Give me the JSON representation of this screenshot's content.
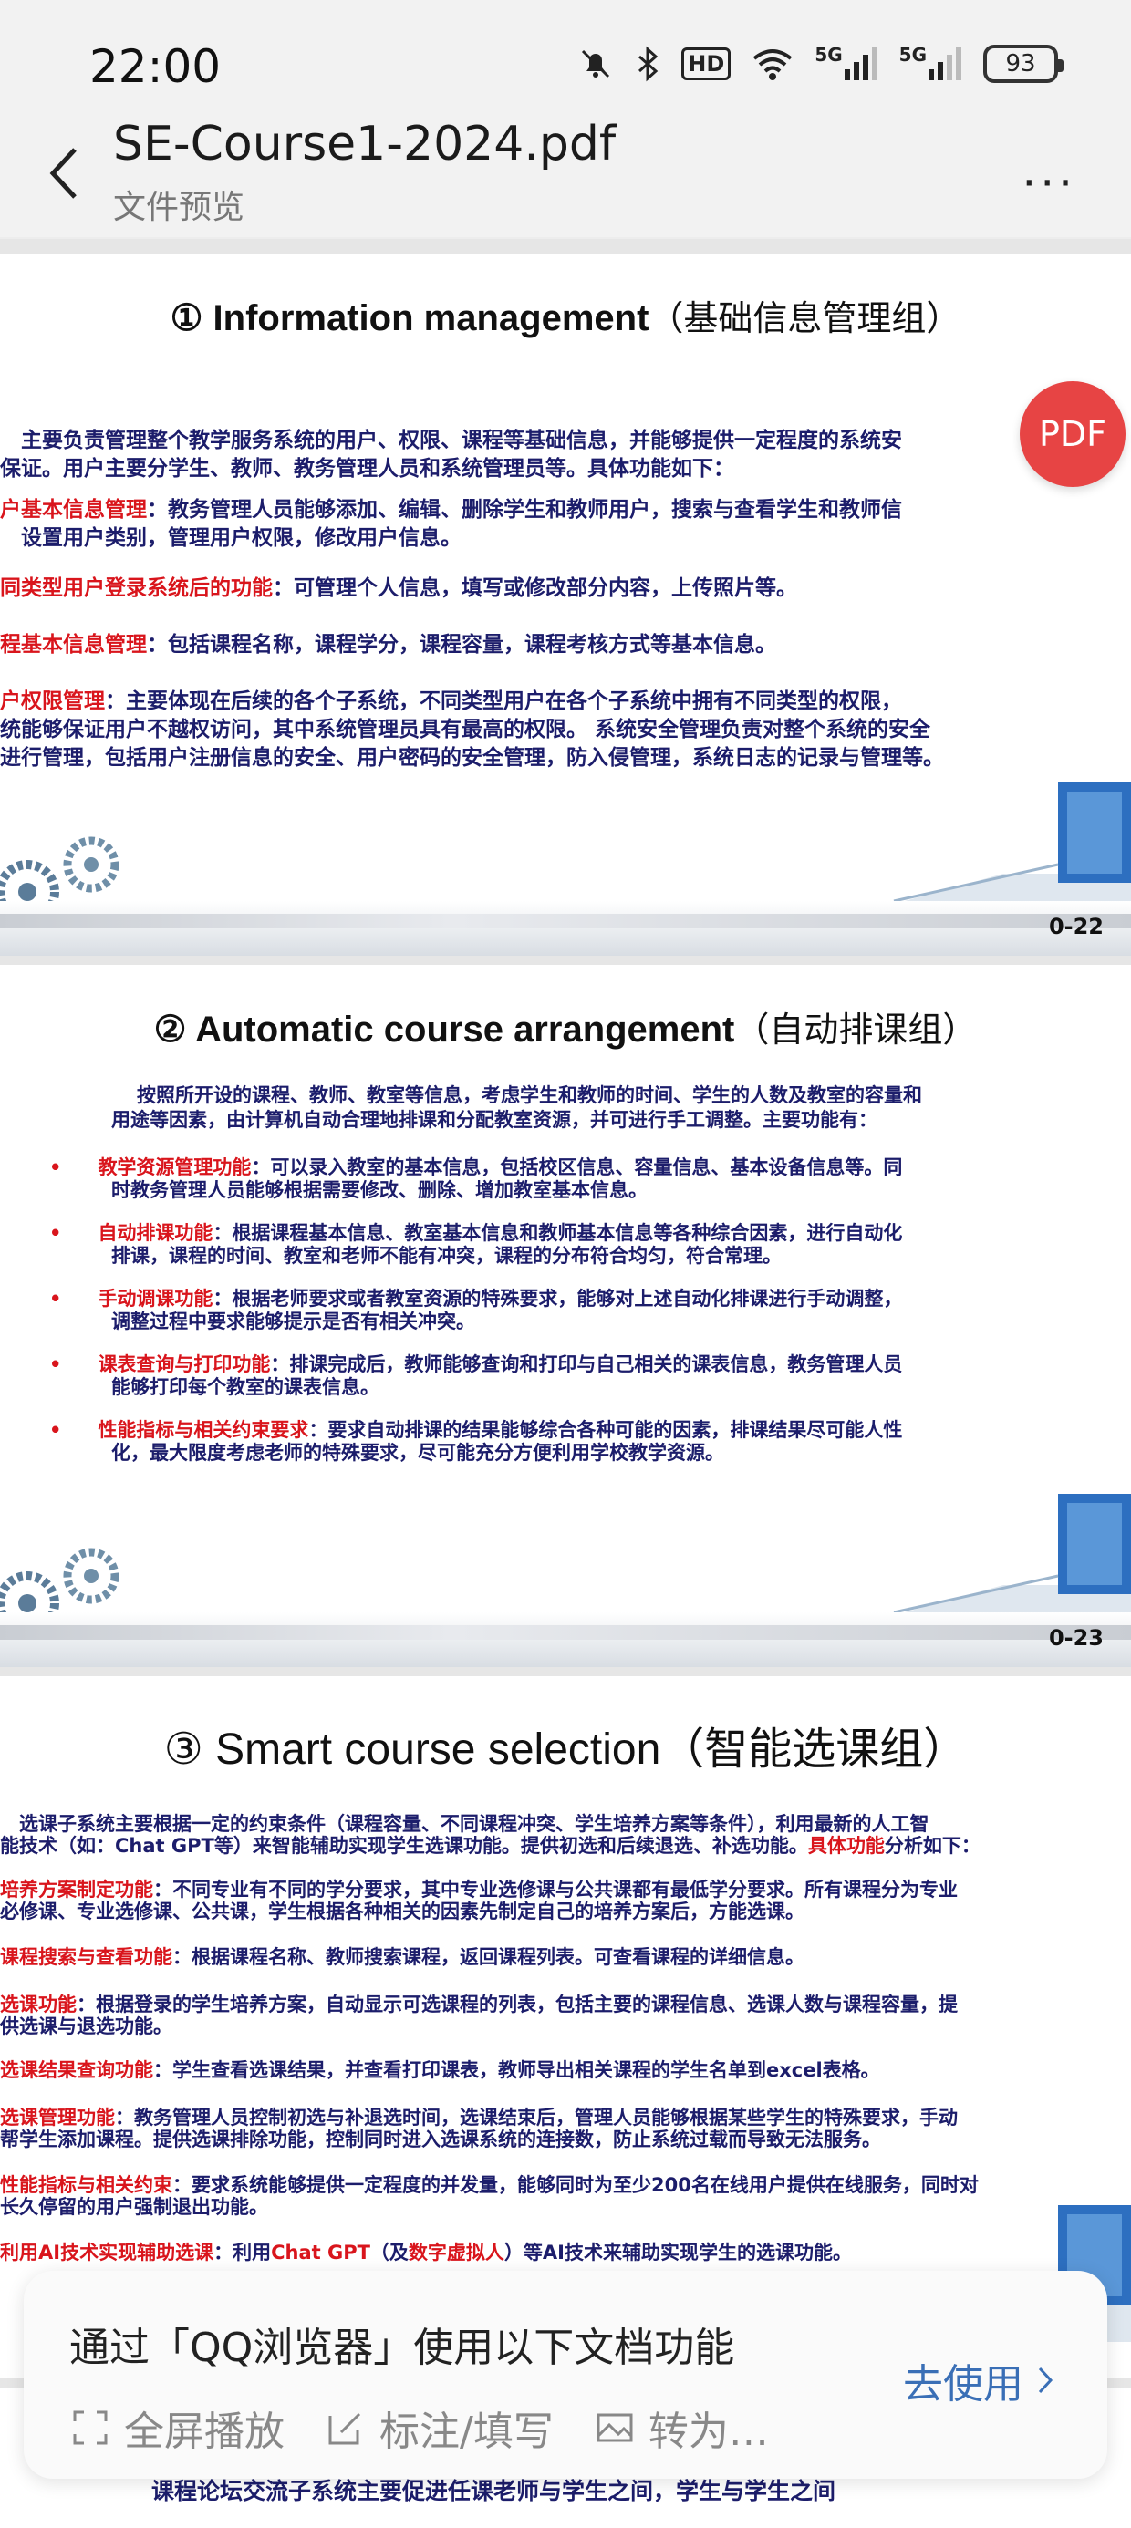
{
  "status_bar": {
    "time": "22:00",
    "icons": [
      "mute-bell-icon",
      "bluetooth-icon",
      "hd-icon",
      "wifi-icon",
      "5g-signal-icon",
      "5g-signal-icon"
    ],
    "hd": "HD",
    "g1": "5G",
    "g2": "5G",
    "battery": "93"
  },
  "header": {
    "title": "SE-Course1-2024.pdf",
    "subtitle": "文件预览",
    "more": "···"
  },
  "pdf_badge": "PDF",
  "slides": [
    {
      "title": "① Information management",
      "title_cn": "（基础信息管理组）",
      "intro": "　主要负责管理整个教学服务系统的用户、权限、课程等基础信息，并能够提供一定程度的系统安",
      "intro2": "保证。用户主要分学生、教师、教务管理人员和系统管理员等。具体功能如下：",
      "items": [
        {
          "label": "户基本信息管理",
          "text": "：教务管理人员能够添加、编辑、删除学生和教师用户，搜索与查看学生和教师信",
          "text2": "　设置用户类别，管理用户权限，修改用户信息。"
        },
        {
          "label": "同类型用户登录系统后的功能",
          "text": "：可管理个人信息，填写或修改部分内容，上传照片等。"
        },
        {
          "label": "程基本信息管理",
          "text": "：包括课程名称，课程学分，课程容量，课程考核方式等基本信息。"
        },
        {
          "label": "户权限管理",
          "text": "：主要体现在后续的各个子系统，不同类型用户在各个子系统中拥有不同类型的权限，",
          "text2": "统能够保证用户不越权访问，其中系统管理员具有最高的权限。 系统安全管理负责对整个系统的安全",
          "text3": "进行管理，包括用户注册信息的安全、用户密码的安全管理，防入侵管理，系统日志的记录与管理等。"
        }
      ],
      "page": "0-22"
    },
    {
      "title": "② Automatic course arrangement",
      "title_cn": "（自动排课组）",
      "intro": "按照所开设的课程、教师、教室等信息，考虑学生和教师的时间、学生的人数及教室的容量和",
      "intro2": "用途等因素，由计算机自动合理地排课和分配教室资源，并可进行手工调整。主要功能有：",
      "items": [
        {
          "label": "教学资源管理功能",
          "text": "：可以录入教室的基本信息，包括校区信息、容量信息、基本设备信息等。同",
          "text2": "时教务管理人员能够根据需要修改、删除、增加教室基本信息。"
        },
        {
          "label": "自动排课功能",
          "text": "：根据课程基本信息、教室基本信息和教师基本信息等各种综合因素，进行自动化",
          "text2": "排课，课程的时间、教室和老师不能有冲突，课程的分布符合均匀，符合常理。"
        },
        {
          "label": "手动调课功能",
          "text": "：根据老师要求或者教室资源的特殊要求，能够对上述自动化排课进行手动调整，",
          "text2": "调整过程中要求能够提示是否有相关冲突。"
        },
        {
          "label": "课表查询与打印功能",
          "text": "：排课完成后，教师能够查询和打印与自己相关的课表信息，教务管理人员",
          "text2": "能够打印每个教室的课表信息。"
        },
        {
          "label": "性能指标与相关约束要求",
          "text": "：要求自动排课的结果能够综合各种可能的因素，排课结果尽可能人性",
          "text2": "化，最大限度考虑老师的特殊要求，尽可能充分方便利用学校教学资源。"
        }
      ],
      "page": "0-23"
    },
    {
      "title": "③ Smart course selection",
      "title_cn": "（智能选课组）",
      "intro": "　选课子系统主要根据一定的约束条件（课程容量、不同课程冲突、学生培养方案等条件），利用最新的人工智",
      "intro2a": "能技术（如：Chat GPT等）来智能辅助实现学生选课功能。提供初选和后续退选、补选功能。",
      "intro2_red": "具体功能",
      "intro2b": "分析如下：",
      "items": [
        {
          "label": "培养方案制定功能",
          "text": "：不同专业有不同的学分要求，其中专业选修课与公共课都有最低学分要求。所有课程分为专业",
          "text2": "必修课、专业选修课、公共课，学生根据各种相关的因素先制定自己的培养方案后，方能选课。"
        },
        {
          "label": "课程搜索与查看功能",
          "text": "：根据课程名称、教师搜索课程，返回课程列表。可查看课程的详细信息。"
        },
        {
          "label": "选课功能",
          "text": "：根据登录的学生培养方案，自动显示可选课程的列表，包括主要的课程信息、选课人数与课程容量，提",
          "text2": "供选课与退选功能。"
        },
        {
          "label": "选课结果查询功能",
          "text": "：学生查看选课结果，并查看打印课表，教师导出相关课程的学生名单到excel表格。"
        },
        {
          "label": "选课管理功能",
          "text": "：教务管理人员控制初选与补退选时间，选课结束后，管理人员能够根据某些学生的特殊要求，手动",
          "text2": "帮学生添加课程。提供选课排除功能，控制同时进入选课系统的连接数，防止系统过载而导致无法服务。"
        },
        {
          "label": "性能指标与相关约束",
          "text": "：要求系统能够提供一定程度的并发量，能够同时为至少200名在线用户提供在线服务，同时对",
          "text2": "长久停留的用户强制退出功能。"
        },
        {
          "label": "利用AI技术实现辅助选课",
          "text": "：利用",
          "red2": "Chat GPT",
          "text_mid": "（及",
          "red3": "数字虚拟人",
          "text_end": "）等AI技术来辅助实现学生的选课功能。"
        }
      ]
    },
    {
      "partial_text": "课程论坛交流子系统主要促进任课老师与学生之间，学生与学生之间"
    }
  ],
  "popup": {
    "title": "通过「QQ浏览器」使用以下文档功能",
    "actions": [
      {
        "label": "全屏播放",
        "icon": "fullscreen-icon"
      },
      {
        "label": "标注/填写",
        "icon": "edit-icon"
      },
      {
        "label": "转为…",
        "icon": "image-convert-icon"
      }
    ],
    "use_button": "去使用",
    "colors": {
      "accent": "#3a6fb6",
      "badge": "#e74444",
      "label_red": "#d9151c",
      "text_navy": "#1c1d6b"
    }
  }
}
